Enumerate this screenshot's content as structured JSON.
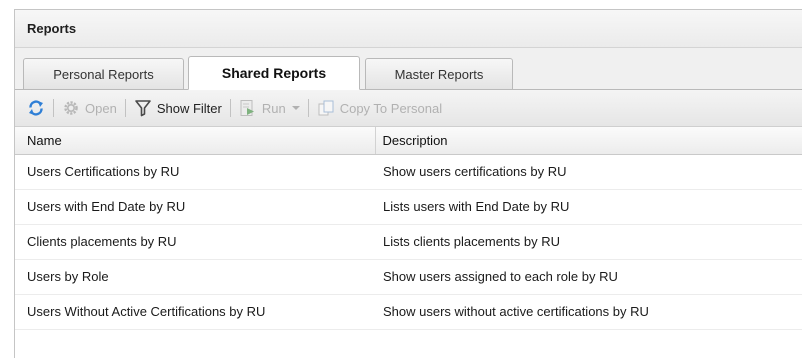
{
  "panel": {
    "title": "Reports"
  },
  "tabs": [
    {
      "label": "Personal Reports",
      "active": false
    },
    {
      "label": "Shared Reports",
      "active": true
    },
    {
      "label": "Master Reports",
      "active": false
    }
  ],
  "toolbar": {
    "refresh_icon": "refresh-icon",
    "open_label": "Open",
    "show_filter_label": "Show Filter",
    "run_label": "Run",
    "copy_label": "Copy To Personal"
  },
  "table": {
    "columns": [
      "Name",
      "Description"
    ],
    "rows": [
      {
        "name": "Users Certifications by RU",
        "description": "Show users certifications by RU"
      },
      {
        "name": "Users with End Date by RU",
        "description": "Lists users with End Date by RU"
      },
      {
        "name": "Clients placements by RU",
        "description": "Lists clients placements by RU"
      },
      {
        "name": "Users by Role",
        "description": "Show users assigned to each role by RU"
      },
      {
        "name": "Users Without Active Certifications by RU",
        "description": "Show users without active certifications by RU"
      }
    ]
  },
  "colors": {
    "refresh_blue": "#2f7fd6",
    "filter_dark": "#4a4a4a",
    "disabled": "#b1b1b1"
  }
}
